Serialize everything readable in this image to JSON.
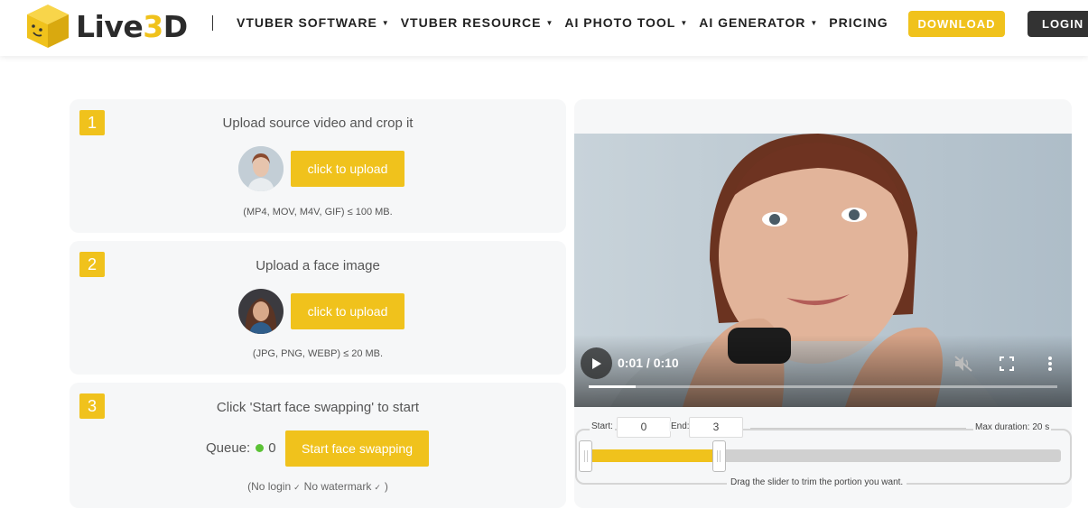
{
  "header": {
    "logo_text_a": "Live",
    "logo_text_b": "3",
    "logo_text_c": "D",
    "nav": [
      {
        "label": "VTUBER SOFTWARE",
        "has_dropdown": true
      },
      {
        "label": "VTUBER RESOURCE",
        "has_dropdown": true
      },
      {
        "label": "AI PHOTO TOOL",
        "has_dropdown": true
      },
      {
        "label": "AI GENERATOR",
        "has_dropdown": true
      },
      {
        "label": "PRICING",
        "has_dropdown": false
      }
    ],
    "download_label": "DOWNLOAD",
    "login_label": "LOGIN"
  },
  "steps": [
    {
      "number": "1",
      "title": "Upload source video and crop it",
      "button": "click to upload",
      "note": "(MP4, MOV, M4V, GIF) ≤ 100 MB."
    },
    {
      "number": "2",
      "title": "Upload a face image",
      "button": "click to upload",
      "note": "(JPG, PNG, WEBP) ≤ 20 MB."
    },
    {
      "number": "3",
      "title": "Click 'Start face swapping' to start",
      "queue_label": "Queue:",
      "queue_count": "0",
      "button": "Start face swapping",
      "perk_1": "No login",
      "perk_2": "No watermark"
    }
  ],
  "video": {
    "time": "0:01 / 0:10",
    "progress": 0.1,
    "muted": true
  },
  "trim": {
    "start_label": "Start:",
    "start_value": "0",
    "end_label": "End:",
    "end_value": "3",
    "max_duration": "Max duration: 20 s",
    "hint": "Drag the slider to trim the portion you want.",
    "range_start_fraction": 0.0,
    "range_end_fraction": 0.28
  },
  "colors": {
    "accent": "#f0c21c",
    "dark_button": "#333333",
    "card_bg": "#f6f7f8",
    "queue_status": "#5bc236"
  }
}
